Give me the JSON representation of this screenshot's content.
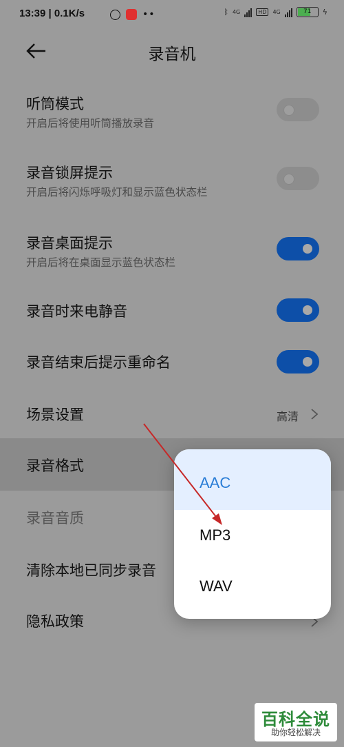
{
  "status_bar": {
    "time": "13:39",
    "net_speed": "0.1K/s",
    "signal1": "4G",
    "signal2": "4G",
    "hd": "HD",
    "battery": "71",
    "battery_level": 0.71
  },
  "header": {
    "title": "录音机",
    "back_icon": "arrow-left-icon"
  },
  "settings": [
    {
      "title": "听筒模式",
      "subtitle": "开启后将使用听筒播放录音",
      "toggle": "off"
    },
    {
      "title": "录音锁屏提示",
      "subtitle": "开启后将闪烁呼吸灯和显示蓝色状态栏",
      "toggle": "off"
    },
    {
      "title": "录音桌面提示",
      "subtitle": "开启后将在桌面显示蓝色状态栏",
      "toggle": "on"
    },
    {
      "title": "录音时来电静音",
      "toggle": "on"
    },
    {
      "title": "录音结束后提示重命名",
      "toggle": "on"
    },
    {
      "title": "场景设置",
      "value": "高清"
    },
    {
      "title": "录音格式"
    },
    {
      "title": "录音音质",
      "disabled": true
    },
    {
      "title": "清除本地已同步录音"
    },
    {
      "title": "隐私政策"
    }
  ],
  "format_menu": {
    "options": [
      "AAC",
      "MP3",
      "WAV"
    ],
    "selected": "AAC"
  },
  "annotation": {
    "arrow_color": "#c62828"
  },
  "watermark": {
    "line1": "百科全说",
    "line2": "助你轻松解决"
  },
  "colors": {
    "accent": "#0d4fa8",
    "selected_text": "#2a7dd6",
    "selected_bg": "#e4efff"
  }
}
